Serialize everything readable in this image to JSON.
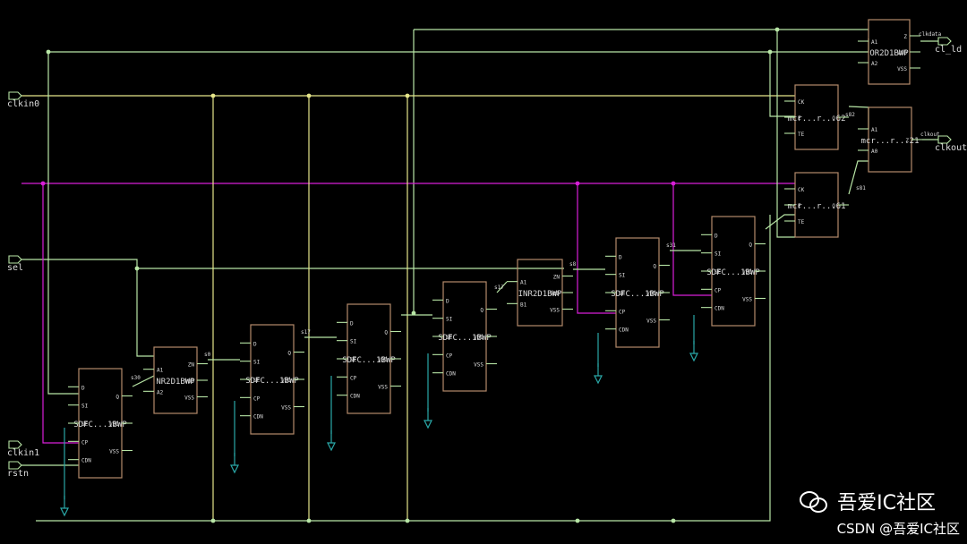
{
  "colors": {
    "background": "#000000",
    "wire_green": "#b8e6a6",
    "wire_yellow": "#e6e68a",
    "wire_magenta": "#d81fd8",
    "wire_cyan": "#2aa8a8",
    "cell_outline": "#b48a6a",
    "text": "#dcdcdc"
  },
  "ports": {
    "clkin0": "clkin0",
    "sel": "sel",
    "clkin1": "clkin1",
    "rstn": "rstn",
    "cl_ld": "cl_ld",
    "clkout": "clkout"
  },
  "cells": [
    {
      "id": "sdfc1",
      "label": "SDFC...1BWP",
      "pins": [
        "D",
        "SI",
        "SE",
        "CP",
        "CDN",
        "Q",
        "VDD",
        "VSS"
      ]
    },
    {
      "id": "nr2",
      "label": "NR2D1BWP",
      "pins": [
        "A1",
        "A2",
        "ZN",
        "VDD",
        "VSS"
      ]
    },
    {
      "id": "sdfc2",
      "label": "SDFC...1BWP",
      "pins": [
        "D",
        "SI",
        "SE",
        "CP",
        "CDN",
        "Q",
        "VDD",
        "VSS"
      ]
    },
    {
      "id": "sdfc3",
      "label": "SDFC...1BWP",
      "pins": [
        "D",
        "SI",
        "SE",
        "CP",
        "CDN",
        "Q",
        "VDD",
        "VSS"
      ]
    },
    {
      "id": "sdfc4",
      "label": "SDFC...1BWP",
      "pins": [
        "D",
        "SI",
        "SE",
        "CP",
        "CDN",
        "Q",
        "VDD",
        "VSS"
      ]
    },
    {
      "id": "inr2",
      "label": "INR2D1BWP",
      "pins": [
        "A1",
        "B1",
        "ZN",
        "VDD",
        "VSS"
      ]
    },
    {
      "id": "sdfc5",
      "label": "SDFC...1BWP",
      "pins": [
        "D",
        "SI",
        "SE",
        "CP",
        "CDN",
        "Q",
        "VDD",
        "VSS"
      ]
    },
    {
      "id": "sdfc6",
      "label": "SDFC...1BWP",
      "pins": [
        "D",
        "SI",
        "SE",
        "CP",
        "CDN",
        "Q",
        "VDD",
        "VSS"
      ]
    },
    {
      "id": "mux61",
      "label": "mcr...r...61",
      "pins": [
        "CK",
        "E",
        "TE",
        "Q"
      ]
    },
    {
      "id": "mux62",
      "label": "mcr...r...62",
      "pins": [
        "CK",
        "E",
        "TE",
        "Q"
      ]
    },
    {
      "id": "mux21",
      "label": "mcr...r...21",
      "pins": [
        "A1",
        "A0",
        "Z"
      ]
    },
    {
      "id": "or2",
      "label": "OR2D1BWP",
      "pins": [
        "A1",
        "A2",
        "Z",
        "VDD",
        "VSS"
      ]
    }
  ],
  "net_labels": {
    "n_q1": "s30",
    "n_zn": "s0",
    "n_q2": "s17",
    "n_q4": "s17",
    "n_inr": "s8",
    "n_q5": "s31",
    "n_m62": "s82",
    "n_m61": "s81",
    "n_clkout": "clkout",
    "n_clld": "clkdata"
  },
  "watermark": {
    "main": "吾爱IC社区",
    "sub": "CSDN @吾爱IC社区"
  }
}
